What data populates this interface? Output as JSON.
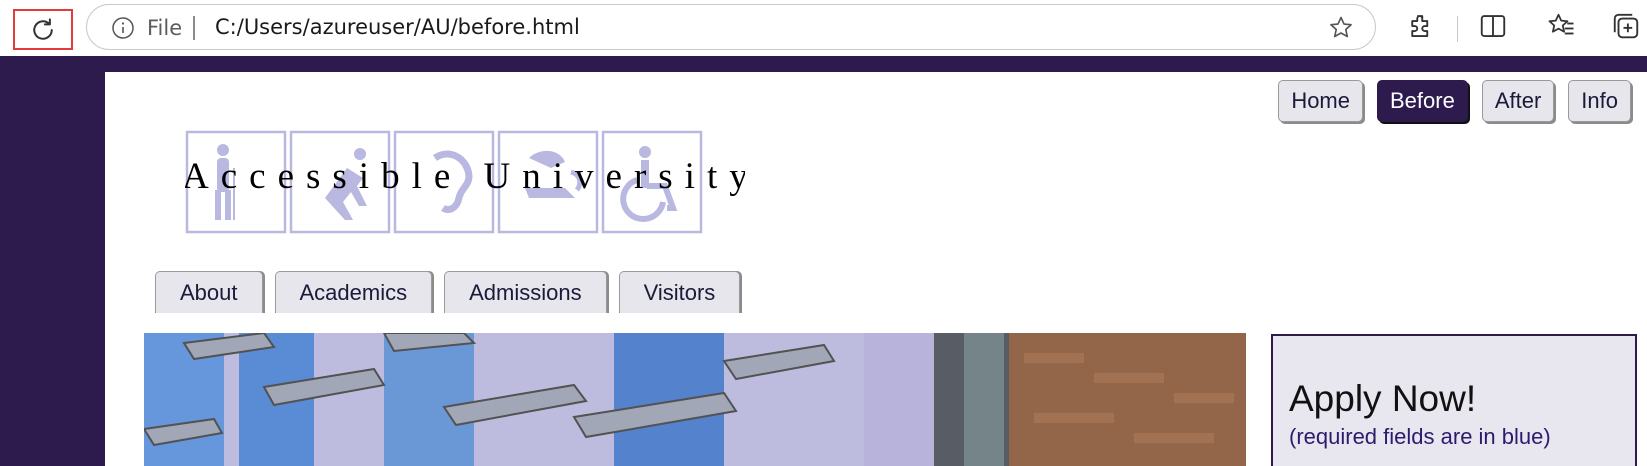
{
  "browser": {
    "file_label": "File",
    "url": "C:/Users/azureuser/AU/before.html",
    "icons": [
      "reload-icon",
      "info-icon",
      "star-icon",
      "extensions-icon",
      "split-screen-icon",
      "favorites-icon",
      "collections-icon"
    ]
  },
  "top_nav": {
    "home": "Home",
    "before": "Before",
    "after": "After",
    "info": "Info"
  },
  "logo": {
    "text": "Accessible University"
  },
  "tabs": [
    "About",
    "Academics",
    "Admissions",
    "Visitors"
  ],
  "apply": {
    "title": "Apply Now!",
    "subtitle": "(required fields are in blue)"
  },
  "colors": {
    "brand": "#2d1b4e",
    "button_bg": "#e6e6ec",
    "highlight": "#e23b3b"
  }
}
